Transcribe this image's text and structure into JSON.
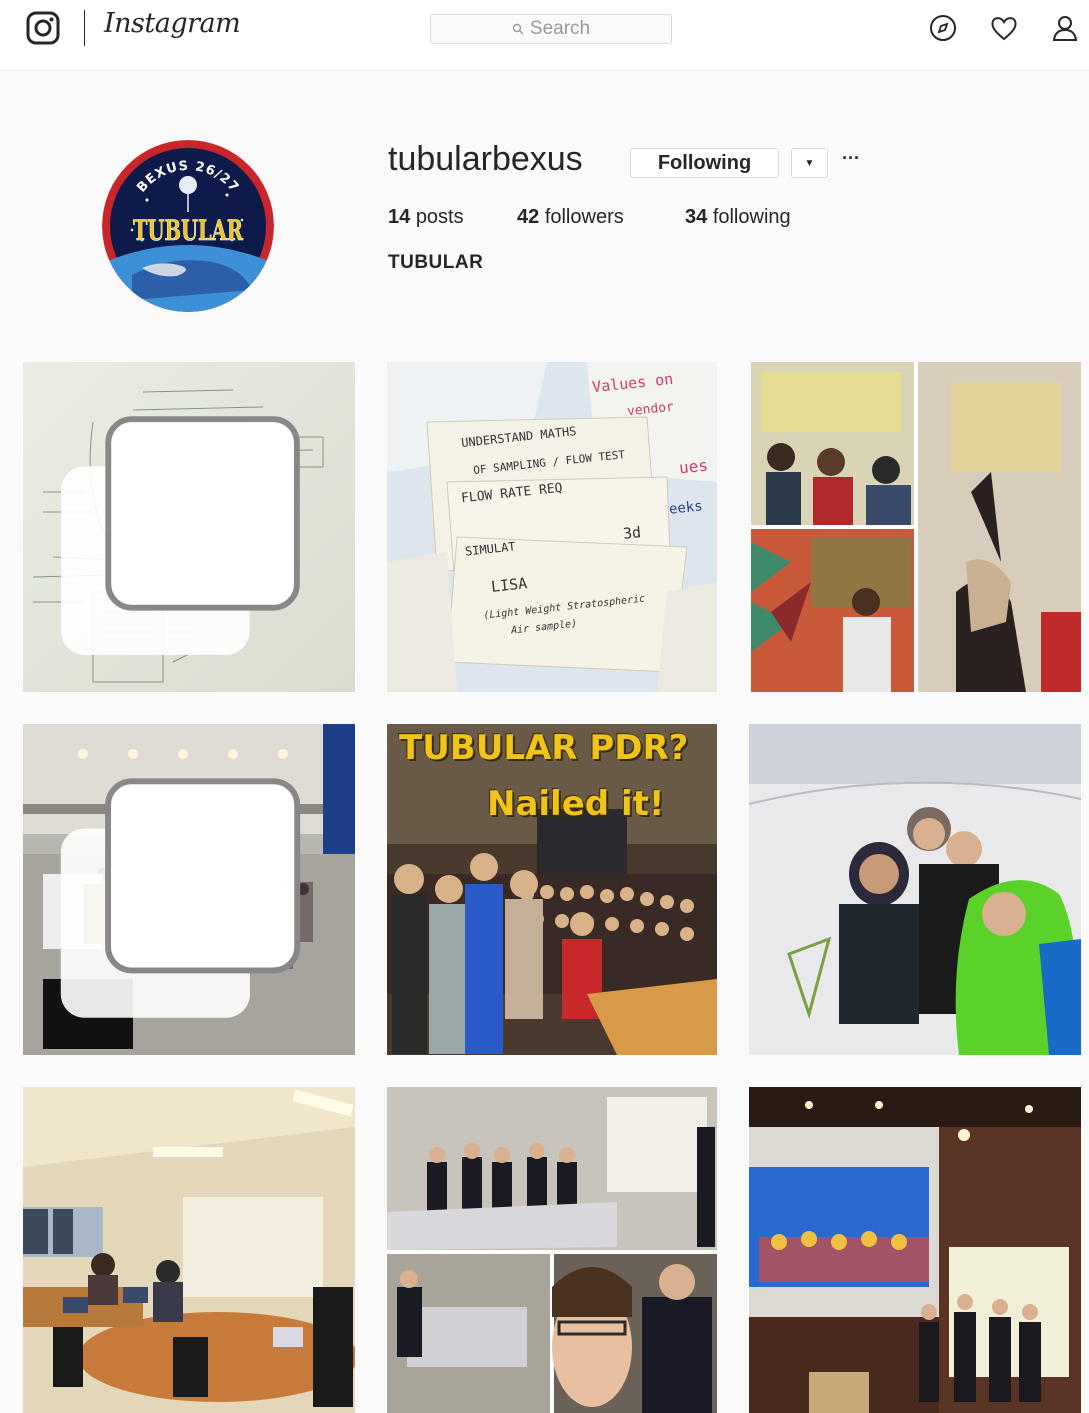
{
  "nav": {
    "logo": "instagram-glyph-icon",
    "wordmark": "Instagram",
    "search_placeholder": "Search",
    "icons": [
      "compass-icon",
      "heart-icon",
      "person-icon"
    ]
  },
  "profile": {
    "username": "tubularbexus",
    "follow_label": "Following",
    "posts_count": "14",
    "posts_label": "posts",
    "followers_count": "42",
    "followers_label": "followers",
    "following_count": "34",
    "following_label": "following",
    "full_name": "TUBULAR",
    "avatar": {
      "badge_top": "BEXUS 26/27",
      "badge_mark": "TUBULAR"
    }
  },
  "posts": [
    {
      "subject": "whiteboard",
      "multi": true
    },
    {
      "subject": "sticky-notes",
      "multi": false
    },
    {
      "subject": "collage",
      "multi": false
    },
    {
      "subject": "hall-crowd",
      "multi": true
    },
    {
      "subject": "group-photo",
      "multi": false,
      "overlay_line1": "TUBULAR PDR?",
      "overlay_line2": "Nailed it!"
    },
    {
      "subject": "snow-selfie",
      "multi": false
    },
    {
      "subject": "office",
      "multi": false
    },
    {
      "subject": "lab-collage",
      "multi": false
    },
    {
      "subject": "presentation",
      "multi": false
    }
  ],
  "sticky_notes": {
    "note1_line1": "UNDERSTAND MATHS",
    "note1_line2": "OF SAMPLING / FLOW TEST",
    "note2_line1": "FLOW RATE REQ",
    "note2_line2": "3d",
    "note3_line1": "SIMULAT",
    "note3_line2": "LISA",
    "note3_line3": "(Light Weight Stratospheric",
    "note3_line4": "Air sample)",
    "scribble1": "Values on",
    "scribble2": "vendor",
    "scribble3": "ues",
    "scribble4": "eeks"
  },
  "colors": {
    "accent": "#262626",
    "border": "#dbdbdb",
    "background": "#fafafa"
  }
}
